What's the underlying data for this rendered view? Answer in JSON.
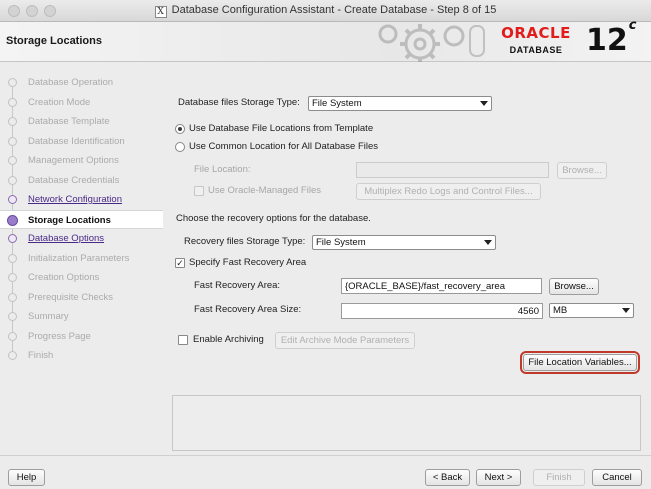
{
  "window": {
    "title": "Database Configuration Assistant - Create Database - Step 8 of 15"
  },
  "banner": {
    "title": "Storage Locations",
    "logo_word": "ORACLE",
    "logo_sub": "DATABASE",
    "version": "12",
    "version_sup": "c"
  },
  "nav": {
    "items": [
      {
        "label": "Database Operation",
        "state": "done"
      },
      {
        "label": "Creation Mode",
        "state": "done"
      },
      {
        "label": "Database Template",
        "state": "done"
      },
      {
        "label": "Database Identification",
        "state": "done"
      },
      {
        "label": "Management Options",
        "state": "done"
      },
      {
        "label": "Database Credentials",
        "state": "done"
      },
      {
        "label": "Network Configuration",
        "state": "link"
      },
      {
        "label": "Storage Locations",
        "state": "current"
      },
      {
        "label": "Database Options",
        "state": "link"
      },
      {
        "label": "Initialization Parameters",
        "state": "pending"
      },
      {
        "label": "Creation Options",
        "state": "pending"
      },
      {
        "label": "Prerequisite Checks",
        "state": "pending"
      },
      {
        "label": "Summary",
        "state": "pending"
      },
      {
        "label": "Progress Page",
        "state": "pending"
      },
      {
        "label": "Finish",
        "state": "pending"
      }
    ]
  },
  "main": {
    "storage_type_label": "Database files Storage Type:",
    "storage_type_value": "File System",
    "radio_template_label": "Use Database File Locations from Template",
    "radio_common_label": "Use Common Location for All Database Files",
    "file_location_label": "File Location:",
    "file_location_value": "",
    "browse_label": "Browse...",
    "use_omf_label": "Use Oracle-Managed Files",
    "multiplex_label": "Multiplex Redo Logs and Control Files...",
    "recovery_intro": "Choose the recovery options for the database.",
    "recovery_type_label": "Recovery files Storage Type:",
    "recovery_type_value": "File System",
    "specify_fra_label": "Specify Fast Recovery Area",
    "fra_label": "Fast Recovery Area:",
    "fra_value": "{ORACLE_BASE}/fast_recovery_area",
    "fra_browse_label": "Browse...",
    "fra_size_label": "Fast Recovery Area Size:",
    "fra_size_value": "4560",
    "fra_size_unit": "MB",
    "archiving_label": "Enable Archiving",
    "archive_params_label": "Edit Archive Mode Parameters",
    "file_location_vars_label": "File Location Variables..."
  },
  "footer": {
    "help": "Help",
    "back": "< Back",
    "next": "Next >",
    "finish": "Finish",
    "cancel": "Cancel"
  }
}
